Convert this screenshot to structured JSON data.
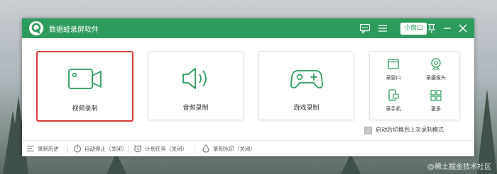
{
  "app": {
    "title": "数据蛙录屏软件",
    "accent": "#2e9b5e",
    "selection_color": "#d63b3b"
  },
  "titlebar": {
    "feedback_icon": "chat-icon",
    "menu_icon": "hamburger-icon",
    "mini_mode_label": "小窗口",
    "pin_icon": "pin-icon",
    "minimize_icon": "minimize-icon",
    "close_icon": "close-icon"
  },
  "modes": [
    {
      "label": "视频录制",
      "icon": "video-camera-icon",
      "selected": true
    },
    {
      "label": "音频录制",
      "icon": "speaker-icon",
      "selected": false
    },
    {
      "label": "游戏录制",
      "icon": "gamepad-icon",
      "selected": false
    }
  ],
  "more_modes": [
    {
      "label": "录窗口",
      "icon": "window-icon"
    },
    {
      "label": "录摄像头",
      "icon": "webcam-icon"
    },
    {
      "label": "录手机",
      "icon": "phone-icon"
    },
    {
      "label": "更多",
      "icon": "grid-icon"
    }
  ],
  "auto_switch": {
    "label": "启动后切换到上次录制模式",
    "checked": false
  },
  "footer": [
    {
      "label": "录制历史",
      "icon": "list-icon"
    },
    {
      "label": "自动停止（关闭）",
      "icon": "stopwatch-icon"
    },
    {
      "label": "计划任务（关闭）",
      "icon": "alarm-clock-icon"
    },
    {
      "label": "录制水印（关闭）",
      "icon": "droplet-icon"
    }
  ],
  "watermark": "@稀土掘金技术社区"
}
